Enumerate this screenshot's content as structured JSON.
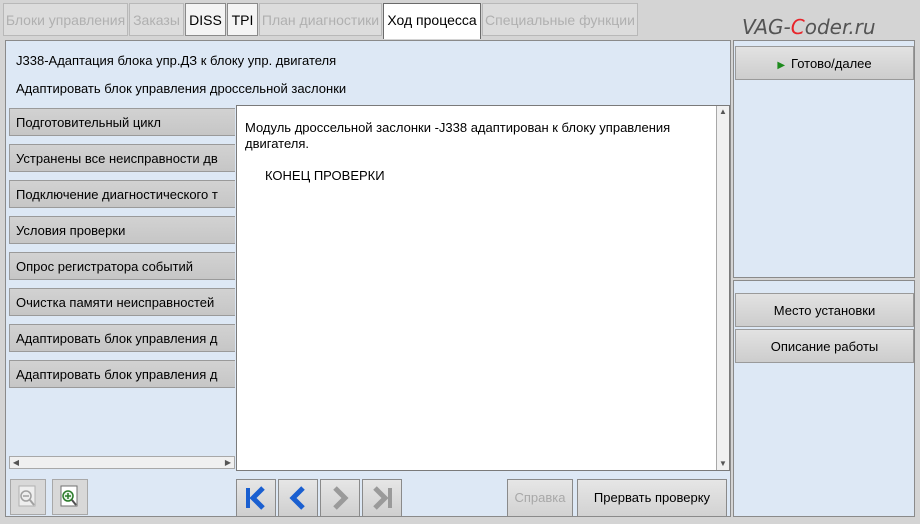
{
  "tabs": [
    {
      "label": "Блоки управления",
      "state": "disabled"
    },
    {
      "label": "Заказы",
      "state": "disabled"
    },
    {
      "label": "DISS",
      "state": "enabled"
    },
    {
      "label": "TPI",
      "state": "enabled"
    },
    {
      "label": "План диагностики",
      "state": "disabled"
    },
    {
      "label": "Ход процесса",
      "state": "active"
    },
    {
      "label": "Специальные функции",
      "state": "disabled"
    }
  ],
  "brand": {
    "part1": "VAG-",
    "part2": "C",
    "part3": "oder.ru",
    "accent": "#e8242a"
  },
  "header": {
    "title1": "J338-Адаптация блока упр.ДЗ к блоку упр. двигателя",
    "title2": "Адаптировать блок управления дроссельной заслонки"
  },
  "steps": [
    "Подготовительный цикл",
    "Устранены все неисправности дв",
    "Подключение диагностического т",
    "Условия проверки",
    "Опрос регистратора событий",
    "Очистка памяти неисправностей",
    "Адаптировать блок управления д",
    "Адаптировать блок управления д"
  ],
  "content": {
    "message": "Модуль дроссельной заслонки -J338 адаптирован к блоку управления двигателя.",
    "end_text": "КОНЕЦ ПРОВЕРКИ"
  },
  "toolbar": {
    "zoom_out_icon": "zoom-out-icon",
    "zoom_in_icon": "zoom-in-icon",
    "help_label": "Справка",
    "abort_label": "Прервать проверку"
  },
  "right": {
    "next_label": "Готово/далее",
    "location_label": "Место установки",
    "description_label": "Описание работы"
  }
}
